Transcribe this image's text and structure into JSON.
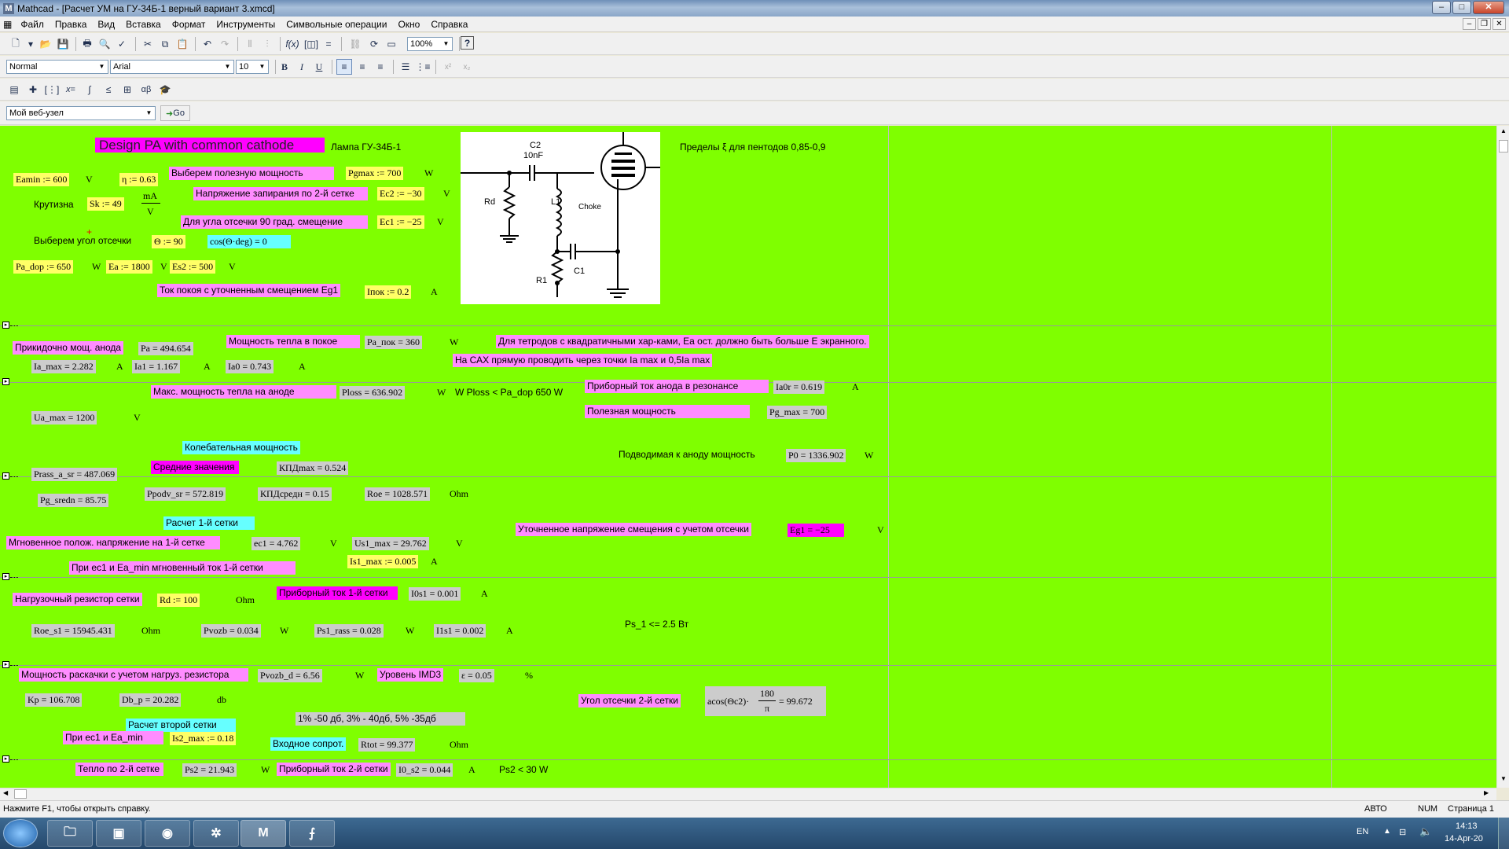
{
  "window": {
    "title": "Mathcad - [Расчет УМ на ГУ-34Б-1  верный вариант 3.xmcd]",
    "icon": "M"
  },
  "menu": [
    "Файл",
    "Правка",
    "Вид",
    "Вставка",
    "Формат",
    "Инструменты",
    "Символьные операции",
    "Окно",
    "Справка"
  ],
  "toolbar": {
    "zoom": "100%",
    "style": "Normal",
    "font": "Arial",
    "size": "10",
    "bold": "B",
    "italic": "I",
    "underline": "U",
    "web": "Мой веб-узел",
    "go": "Go"
  },
  "ws": {
    "title": "Design PA with common cathode",
    "tube": "Лампа ГУ-34Б-1",
    "pentode": "Пределы ξ для пентодов  0,85-0,9",
    "eamin": "Eamin := 600",
    "eamin_u": "V",
    "eta": "η := 0.63",
    "vyb": "Выберем полезную мощность",
    "pgmax": "Pgmax := 700",
    "pgmax_u": "W",
    "krut": "Крутизна",
    "sk": "Sk := 49",
    "sk_u1": "mA",
    "sk_u2": "V",
    "ec2_l": "Напряжение запирания по 2-й сетке",
    "ec2": "Ec2 := −30",
    "ec2_u": "V",
    "ec1_l": "Для угла отсечки 90 град. смещение",
    "ec1": "Ec1 := −25",
    "ec1_u": "V",
    "theta_l": "Выберем угол отсечки",
    "theta": "Θ := 90",
    "cos": "cos(Θ·deg) = 0",
    "pa_dop": "Pa_dop := 650",
    "pa_dop_u": "W",
    "ea": "Ea := 1800",
    "ea_u": "V",
    "es2": "Es2 := 500",
    "es2_u": "V",
    "ipok_l": "Ток покоя с уточненным смещением Eg1",
    "ipok": "Iпок := 0.2",
    "ipok_u": "A",
    "pa_l": "Прикидочно мощ. анода",
    "pa": "Pa = 494.654",
    "papok_l": "Мощность тепла в покое",
    "papok": "Pa_пок = 360",
    "papok_u": "W",
    "tetr": "Для тетродов с квадратичными хар-ками, Ea ост. должно быть больше E экранного.",
    "cax": "На САХ прямую проводить через точки Ia max  и 0,5Ia max",
    "iamax": "Ia_max = 2.282",
    "iamax_u": "A",
    "ia1": "Ia1 = 1.167",
    "ia1_u": "A",
    "ia0": "Ia0 = 0.743",
    "ia0_u": "A",
    "ploss_l": "Макс. мощность тепла на аноде",
    "ploss": "Ploss = 636.902",
    "ploss_u": "W",
    "ploss_cmp": "W  Ploss < Pa_dop 650 W",
    "ia0r_l": "Приборный ток анода  в резонансе",
    "ia0r": "Ia0r = 0.619",
    "ia0r_u": "A",
    "pgmx_l": "Полезная мощность",
    "pgmx": "Pg_max = 700",
    "uamax": "Ua_max = 1200",
    "uamax_u": "V",
    "kol": "Колебательная мощность",
    "p0_l": "Подводимая к аноду мощность",
    "p0": "P0 = 1336.902",
    "p0_u": "W",
    "prass": "Prass_a_sr = 487.069",
    "sred": "Средние значения",
    "kpdmax": "КПДmax = 0.524",
    "pgsr": "Pg_sredn = 85.75",
    "ppodv": "Ppodv_sr = 572.819",
    "kpdsr": "КПДсредн = 0.15",
    "roe": "Roe = 1028.571",
    "roe_u": "Ohm",
    "r1s": "Расчет 1-й сетки",
    "egl_l": "Уточненное напряжение смещения с учетом отсечки",
    "eg1": "Eg1 = −25",
    "eg1_u": "V",
    "mgn": "Мгновенное полож. напряжение на 1-й сетке",
    "ec1v": "ec1 = 4.762",
    "ec1v_u": "V",
    "us1": "Us1_max = 29.762",
    "us1_u": "V",
    "pri": "При ec1  и Ea_min мгновенный ток 1-й сетки",
    "is1": "Is1_max := 0.005",
    "is1_u": "A",
    "rd_l": "Нагрузочный резистор сетки",
    "rd": "Rd := 100",
    "rd_u": "Ohm",
    "io1_l": "Приборный ток 1-й сетки",
    "io1": "I0s1 = 0.001",
    "io1_u": "A",
    "roes1": "Roe_s1 = 15945.431",
    "roes1_u": "Ohm",
    "pvozb": "Pvozb = 0.034",
    "pvozb_u": "W",
    "ps1": "Ps1_rass = 0.028",
    "ps1_u": "W",
    "i1s1": "I1s1 = 0.002",
    "i1s1_u": "A",
    "ps1lim": "Ps_1 <= 2.5 Вт",
    "raskach": "Мощность раскачки с учетом нагруз. резистора",
    "pvozbd": "Pvozb_d = 6.56",
    "pvozbd_u": "W",
    "imd_l": "Уровень IMD3",
    "eps": "ε = 0.05",
    "eps_u": "%",
    "ugol": "Угол отсечки 2-й сетки",
    "acos": "acos(Θc2)·",
    "acos_n": "180",
    "acos_d": "π",
    "acos_r": "= 99.672",
    "kp": "Kp = 106.708",
    "dbp": "Db_p = 20.282",
    "db_u": "db",
    "imdtab": "1% -50 дб, 3% - 40дб, 5% -35дб",
    "r2s": "Расчет второй сетки",
    "pri2": "При ec1 и Ea_min",
    "is2": "Is2_max := 0.18",
    "vhod": "Входное сопрот.",
    "rtot": "Rtot = 99.377",
    "rtot_u": "Ohm",
    "teplo2": "Тепло по 2-й сетке",
    "ps2": "Ps2 = 21.943",
    "ps2_u": "W",
    "i0s2_l": "Приборный ток 2-й сетки",
    "i0s2": "I0_s2 = 0.044",
    "i0s2_u": "A",
    "ps2lim": "Ps2 < 30 W"
  },
  "schematic": {
    "c2": "C2",
    "c2v": "10nF",
    "rd": "Rd",
    "l1": "L1",
    "choke": "Choke",
    "r1": "R1",
    "c1": "C1"
  },
  "status": {
    "hint": "Нажмите F1, чтобы открыть справку.",
    "mode": "АВТО",
    "num": "NUM",
    "page": "Страница 1"
  },
  "taskbar": {
    "lang": "EN",
    "time": "14:13",
    "date": "14-Apr-20"
  }
}
